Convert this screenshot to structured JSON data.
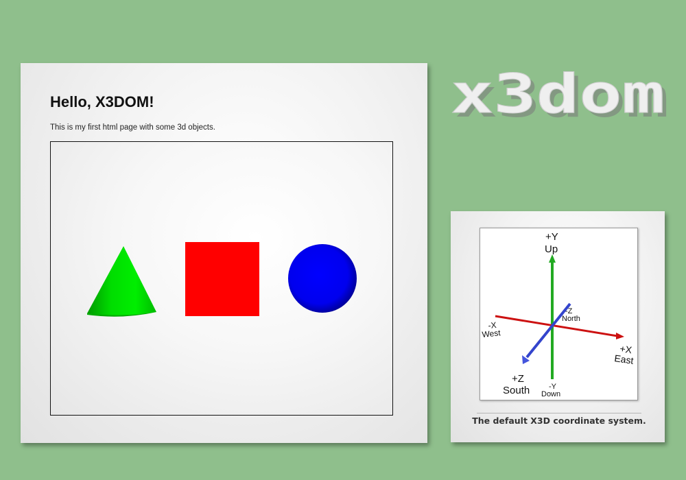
{
  "main": {
    "title": "Hello, X3DOM!",
    "intro": "This is my first html page with some 3d objects.",
    "scene": {
      "objects": [
        {
          "shape": "cone",
          "color": "#00cc00"
        },
        {
          "shape": "box",
          "color": "#ff0000"
        },
        {
          "shape": "sphere",
          "color": "#0000ee"
        }
      ]
    }
  },
  "logo": {
    "text": "x3dom"
  },
  "coordinate_figure": {
    "labels": {
      "pos_y": "+Y",
      "up": "Up",
      "neg_z": "-Z",
      "north": "North",
      "neg_x": "-X",
      "west": "West",
      "pos_x": "+X",
      "east": "East",
      "pos_z": "+Z",
      "south": "South",
      "neg_y": "-Y",
      "down": "Down"
    },
    "axis_colors": {
      "x": "#cc1111",
      "y": "#22aa22",
      "z": "#3344cc"
    },
    "caption": "The default X3D coordinate system."
  }
}
